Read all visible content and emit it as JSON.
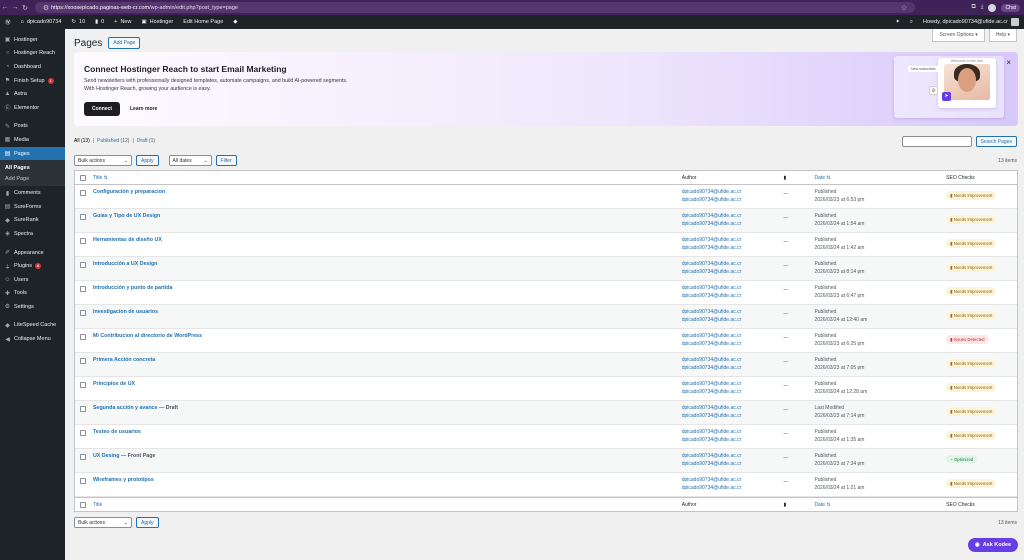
{
  "browser": {
    "url_domain": "https://xoosepicado.paginas-web-cr.com",
    "url_path": "/wp-admin/edit.php?post_type=page",
    "profile": "Chat"
  },
  "adminbar": {
    "site": "dpicado90734",
    "updates": "10",
    "comments": "0",
    "new": "New",
    "hostinger": "Hostinger",
    "edit_home": "Edit Home Page",
    "howdy": "Howdy, dpicado90734@ufide.ac.cr"
  },
  "sidebar": {
    "items": [
      {
        "label": "Hostinger",
        "icon": "hostinger-icon"
      },
      {
        "label": "Hostinger Reach",
        "icon": "circle-icon"
      },
      {
        "label": "Dashboard",
        "icon": "dashboard-icon"
      },
      {
        "label": "Finish Setup",
        "icon": "flag-icon",
        "badge": "1"
      },
      {
        "label": "Astra",
        "icon": "astra-icon"
      },
      {
        "label": "Elementor",
        "icon": "elementor-icon"
      },
      {
        "label": "Posts",
        "icon": "pin-icon"
      },
      {
        "label": "Media",
        "icon": "media-icon"
      },
      {
        "label": "Pages",
        "icon": "pages-icon"
      },
      {
        "label": "Comments",
        "icon": "comment-icon"
      },
      {
        "label": "SureForms",
        "icon": "sureforms-icon"
      },
      {
        "label": "SureRank",
        "icon": "surerank-icon"
      },
      {
        "label": "Spectra",
        "icon": "spectra-icon"
      },
      {
        "label": "Appearance",
        "icon": "brush-icon"
      },
      {
        "label": "Plugins",
        "icon": "plug-icon",
        "badge": "6"
      },
      {
        "label": "Users",
        "icon": "user-icon"
      },
      {
        "label": "Tools",
        "icon": "wrench-icon"
      },
      {
        "label": "Settings",
        "icon": "settings-icon"
      },
      {
        "label": "LiteSpeed Cache",
        "icon": "litespeed-icon"
      },
      {
        "label": "Collapse Menu",
        "icon": "collapse-icon"
      }
    ],
    "sub": {
      "all": "All Pages",
      "add": "Add Page"
    }
  },
  "page": {
    "title": "Pages",
    "add_new": "Add Page",
    "screen_options": "Screen Options ▾",
    "help": "Help ▾"
  },
  "banner": {
    "title": "Connect Hostinger Reach to start Email Marketing",
    "line1": "Send newsletters with professionally designed templates, automate campaigns, and build AI-powered segments.",
    "line2": "With Hostinger Reach, growing your audience is easy.",
    "connect": "Connect",
    "learn": "Learn more",
    "welcome": "Welcome to the club",
    "new_sub": "New subscriber"
  },
  "filters": {
    "all": "All",
    "all_count": "(13)",
    "published": "Published",
    "published_count": "(12)",
    "draft": "Draft",
    "draft_count": "(1)",
    "sep": "|"
  },
  "search": {
    "button": "Search Pages"
  },
  "nav": {
    "bulk": "Bulk actions",
    "apply": "Apply",
    "dates": "All dates",
    "filter": "Filter",
    "items": "13 items"
  },
  "table": {
    "headers": {
      "title": "Title",
      "author": "Author",
      "date": "Date",
      "seo": "SEO Checks"
    },
    "rows": [
      {
        "title": "Configuración y preparacion",
        "state": "",
        "author": "dpicado90734@ufide.ac.cr",
        "comments": "—",
        "status": "Published",
        "date": "2026/03/23 at 6:53 pm",
        "seo": "Needs Improvement",
        "seo_type": "warn"
      },
      {
        "title": "Guias y Tipo de UX Design",
        "state": "",
        "author": "dpicado90734@ufide.ac.cr",
        "comments": "—",
        "status": "Published",
        "date": "2026/03/24 at 1:54 am",
        "seo": "Needs Improvement",
        "seo_type": "warn"
      },
      {
        "title": "Herramientas de diseño UX",
        "state": "",
        "author": "dpicado90734@ufide.ac.cr",
        "comments": "—",
        "status": "Published",
        "date": "2026/03/24 at 1:42 am",
        "seo": "Needs Improvement",
        "seo_type": "warn"
      },
      {
        "title": "Introducción a UX Design",
        "state": "",
        "author": "dpicado90734@ufide.ac.cr",
        "comments": "—",
        "status": "Published",
        "date": "2026/03/23 at 8:14 pm",
        "seo": "Needs Improvement",
        "seo_type": "warn"
      },
      {
        "title": "Introducción y punto de partida",
        "state": "",
        "author": "dpicado90734@ufide.ac.cr",
        "comments": "—",
        "status": "Published",
        "date": "2026/03/23 at 6:47 pm",
        "seo": "Needs Improvement",
        "seo_type": "warn"
      },
      {
        "title": "Investigacion de usuarios",
        "state": "",
        "author": "dpicado90734@ufide.ac.cr",
        "comments": "—",
        "status": "Published",
        "date": "2026/03/24 at 12:40 am",
        "seo": "Needs Improvement",
        "seo_type": "warn"
      },
      {
        "title": "Mi Contribucion al directorio de WordPress",
        "state": "",
        "author": "dpicado90734@ufide.ac.cr",
        "comments": "—",
        "status": "Published",
        "date": "2026/03/23 at 6:25 pm",
        "seo": "Issues Detected",
        "seo_type": "err"
      },
      {
        "title": "Primera Acción concreta",
        "state": "",
        "author": "dpicado90734@ufide.ac.cr",
        "comments": "—",
        "status": "Published",
        "date": "2026/03/23 at 7:05 pm",
        "seo": "Needs Improvement",
        "seo_type": "warn"
      },
      {
        "title": "Principios de UX",
        "state": "",
        "author": "dpicado90734@ufide.ac.cr",
        "comments": "—",
        "status": "Published",
        "date": "2026/03/24 at 12:28 am",
        "seo": "Needs Improvement",
        "seo_type": "warn"
      },
      {
        "title": "Segunda acción y avance",
        "state": "— Draft",
        "author": "dpicado90734@ufide.ac.cr",
        "comments": "—",
        "status": "Last Modified",
        "date": "2026/03/23 at 7:14 pm",
        "seo": "Needs Improvement",
        "seo_type": "warn"
      },
      {
        "title": "Testeo de usuarios",
        "state": "",
        "author": "dpicado90734@ufide.ac.cr",
        "comments": "—",
        "status": "Published",
        "date": "2026/03/24 at 1:35 am",
        "seo": "Needs Improvement",
        "seo_type": "warn"
      },
      {
        "title": "UX Desing",
        "state": "— Front Page",
        "author": "dpicado90734@ufide.ac.cr",
        "comments": "—",
        "status": "Published",
        "date": "2026/03/23 at 7:34 pm",
        "seo": "Optimized",
        "seo_type": "ok"
      },
      {
        "title": "Wireframes y prototipos",
        "state": "",
        "author": "dpicado90734@ufide.ac.cr",
        "comments": "—",
        "status": "Published",
        "date": "2026/03/24 at 1:21 am",
        "seo": "Needs Improvement",
        "seo_type": "warn"
      }
    ]
  },
  "ask": {
    "label": "Ask Kodee"
  },
  "colors": {
    "wp_blue": "#2271b1",
    "admin_dark": "#1d2327",
    "browser_purple": "#3f2358",
    "kodee_purple": "#673de6"
  }
}
